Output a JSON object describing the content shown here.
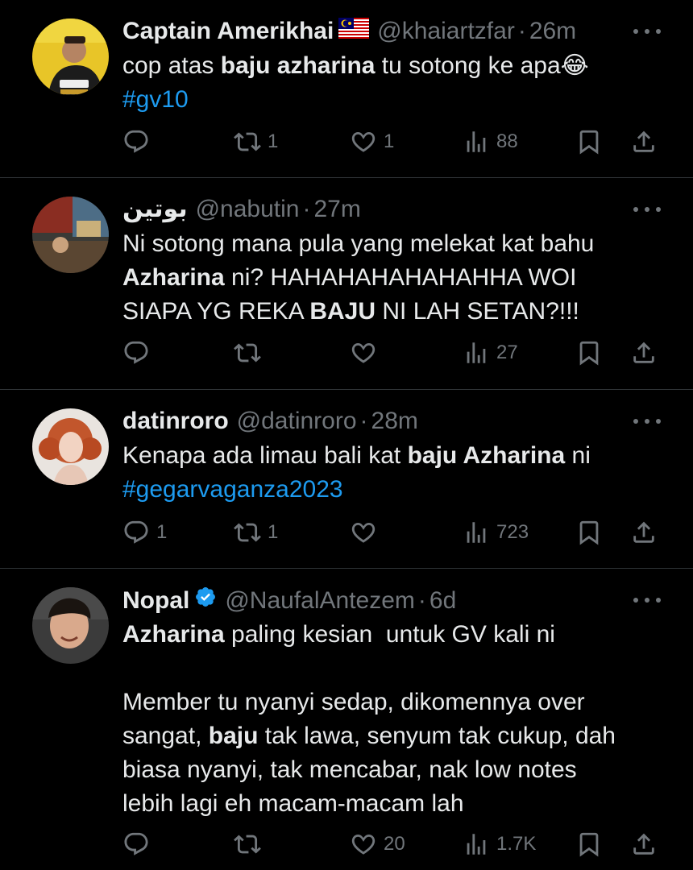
{
  "tweets": [
    {
      "name": "Captain Amerikhai",
      "flag": "malaysia-flag",
      "handle": "@khaiartzfar",
      "dot": "·",
      "time": "26m",
      "text": {
        "p1": "cop atas ",
        "b1": "baju azharina",
        "p2": " tu sotong ke apa",
        "emoji": "😂",
        "tag": "#gv10"
      },
      "replies": "",
      "reposts": "1",
      "likes": "1",
      "views": "88"
    },
    {
      "name": "بوتين",
      "handle": "@nabutin",
      "dot": "·",
      "time": "27m",
      "text": {
        "p1": "Ni sotong mana pula yang melekat kat bahu\n",
        "b1": "Azharina",
        "p2": " ni? HAHAHAHAHAHAHHA WOI\nSIAPA YG REKA ",
        "b2": "BAJU",
        "p3": " NI LAH SETAN?!!!"
      },
      "replies": "",
      "reposts": "",
      "likes": "",
      "views": "27"
    },
    {
      "name": "datinroro",
      "handle": "@datinroro",
      "dot": "·",
      "time": "28m",
      "text": {
        "p1": "Kenapa ada limau bali kat ",
        "b1": "baju Azharina",
        "p2": " ni\n",
        "tag": "#gegarvaganza2023"
      },
      "replies": "1",
      "reposts": "1",
      "likes": "",
      "views": "723"
    },
    {
      "name": "Nopal",
      "verified": "verified-badge-icon",
      "handle": "@NaufalAntezem",
      "dot": "·",
      "time": "6d",
      "text": {
        "b1": "Azharina",
        "p1": " paling kesian  untuk GV kali ni\n\nMember tu nyanyi sedap, dikomennya over\nsangat, ",
        "b2": "baju",
        "p2": " tak lawa, senyum tak cukup, dah\nbiasa nyanyi, tak mencabar, nak low notes\nlebih lagi eh macam-macam lah"
      },
      "replies": "",
      "reposts": "",
      "likes": "20",
      "views": "1.7K"
    }
  ],
  "colors": {
    "background": "#000000",
    "text": "#e7e9ea",
    "muted": "#71767b",
    "link": "#1d9bf0",
    "divider": "#2f3336",
    "verified": "#1d9bf0"
  }
}
